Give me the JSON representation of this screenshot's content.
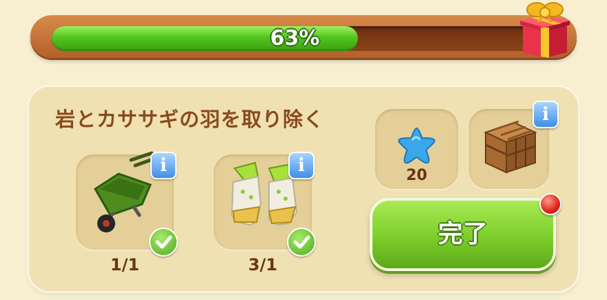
{
  "progress": {
    "value": 0.63,
    "label": "63%"
  },
  "task": {
    "title": "岩とカササギの羽を取り除く",
    "items": [
      {
        "name": "wheelbarrow",
        "icon": "wheelbarrow-icon",
        "count": "1/1",
        "done": true
      },
      {
        "name": "garden-gloves",
        "icon": "gloves-icon",
        "count": "3/1",
        "done": true
      }
    ]
  },
  "rewards": [
    {
      "icon": "blue-star-icon",
      "amount": "20"
    },
    {
      "icon": "wooden-crate-icon",
      "amount": ""
    }
  ],
  "complete_button": {
    "label": "完了"
  },
  "colors": {
    "progress_fill": "#52c41f",
    "title_text": "#8a4a1d",
    "button_green": "#7ccd2a",
    "notification_red": "#e0231a",
    "info_blue": "#3f8fe6"
  }
}
